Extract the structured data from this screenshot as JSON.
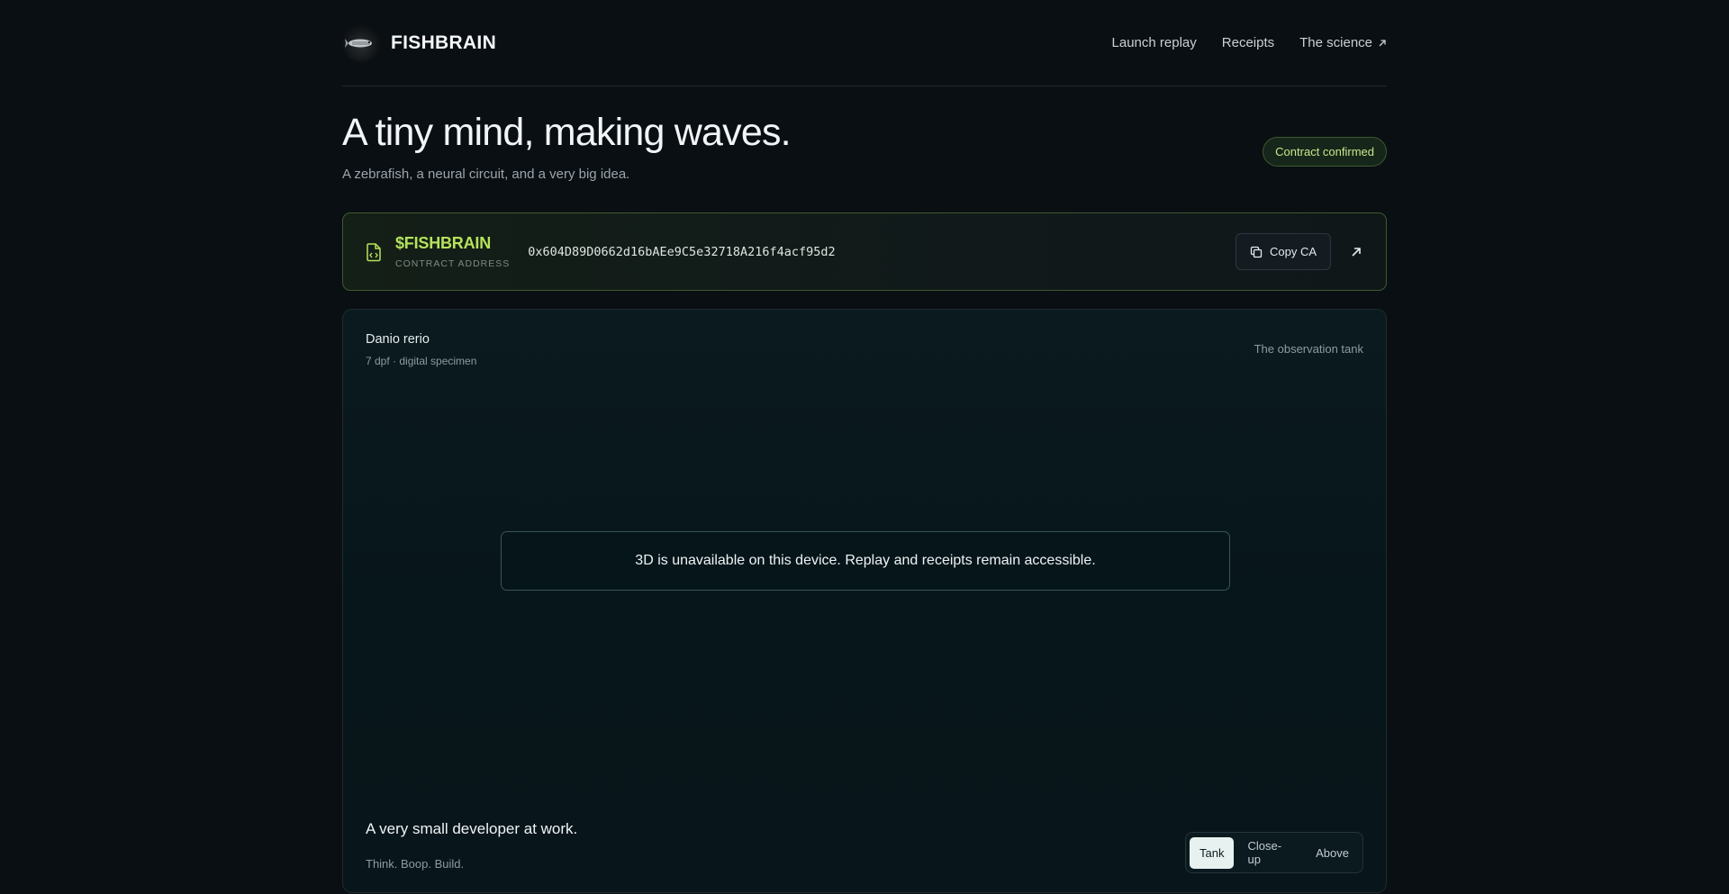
{
  "brand": {
    "name": "FISHBRAIN",
    "logo_icon": "fish-avatar"
  },
  "nav": {
    "items": [
      {
        "label": "Launch replay"
      },
      {
        "label": "Receipts"
      },
      {
        "label": "The science",
        "icon": "arrow-up-right-icon"
      }
    ]
  },
  "hero": {
    "title": "A tiny mind, making waves.",
    "subtitle": "A zebrafish, a neural circuit, and a very big idea.",
    "badge": "Contract confirmed"
  },
  "contract": {
    "icon": "file-code-icon",
    "ticker": "$FISHBRAIN",
    "label": "CONTRACT ADDRESS",
    "address": "0x604D89D0662d16bAEe9C5e32718A216f4acf95d2",
    "copy_label": "Copy CA",
    "copy_icon": "copy-icon",
    "external_icon": "arrow-up-right-icon"
  },
  "tank": {
    "species": "Danio rerio",
    "specimen": "7 dpf · digital specimen",
    "title": "The observation tank",
    "notice": "3D is unavailable on this device. Replay and receipts remain accessible.",
    "caption": "A very small developer at work.",
    "caption_sub": "Think. Boop. Build.",
    "views": [
      {
        "label": "Tank",
        "active": true
      },
      {
        "label": "Close-up",
        "active": false
      },
      {
        "label": "Above",
        "active": false
      }
    ]
  },
  "colors": {
    "accent": "#b6e35a",
    "background": "#0a0f13",
    "badge_text": "#c7e88a"
  }
}
